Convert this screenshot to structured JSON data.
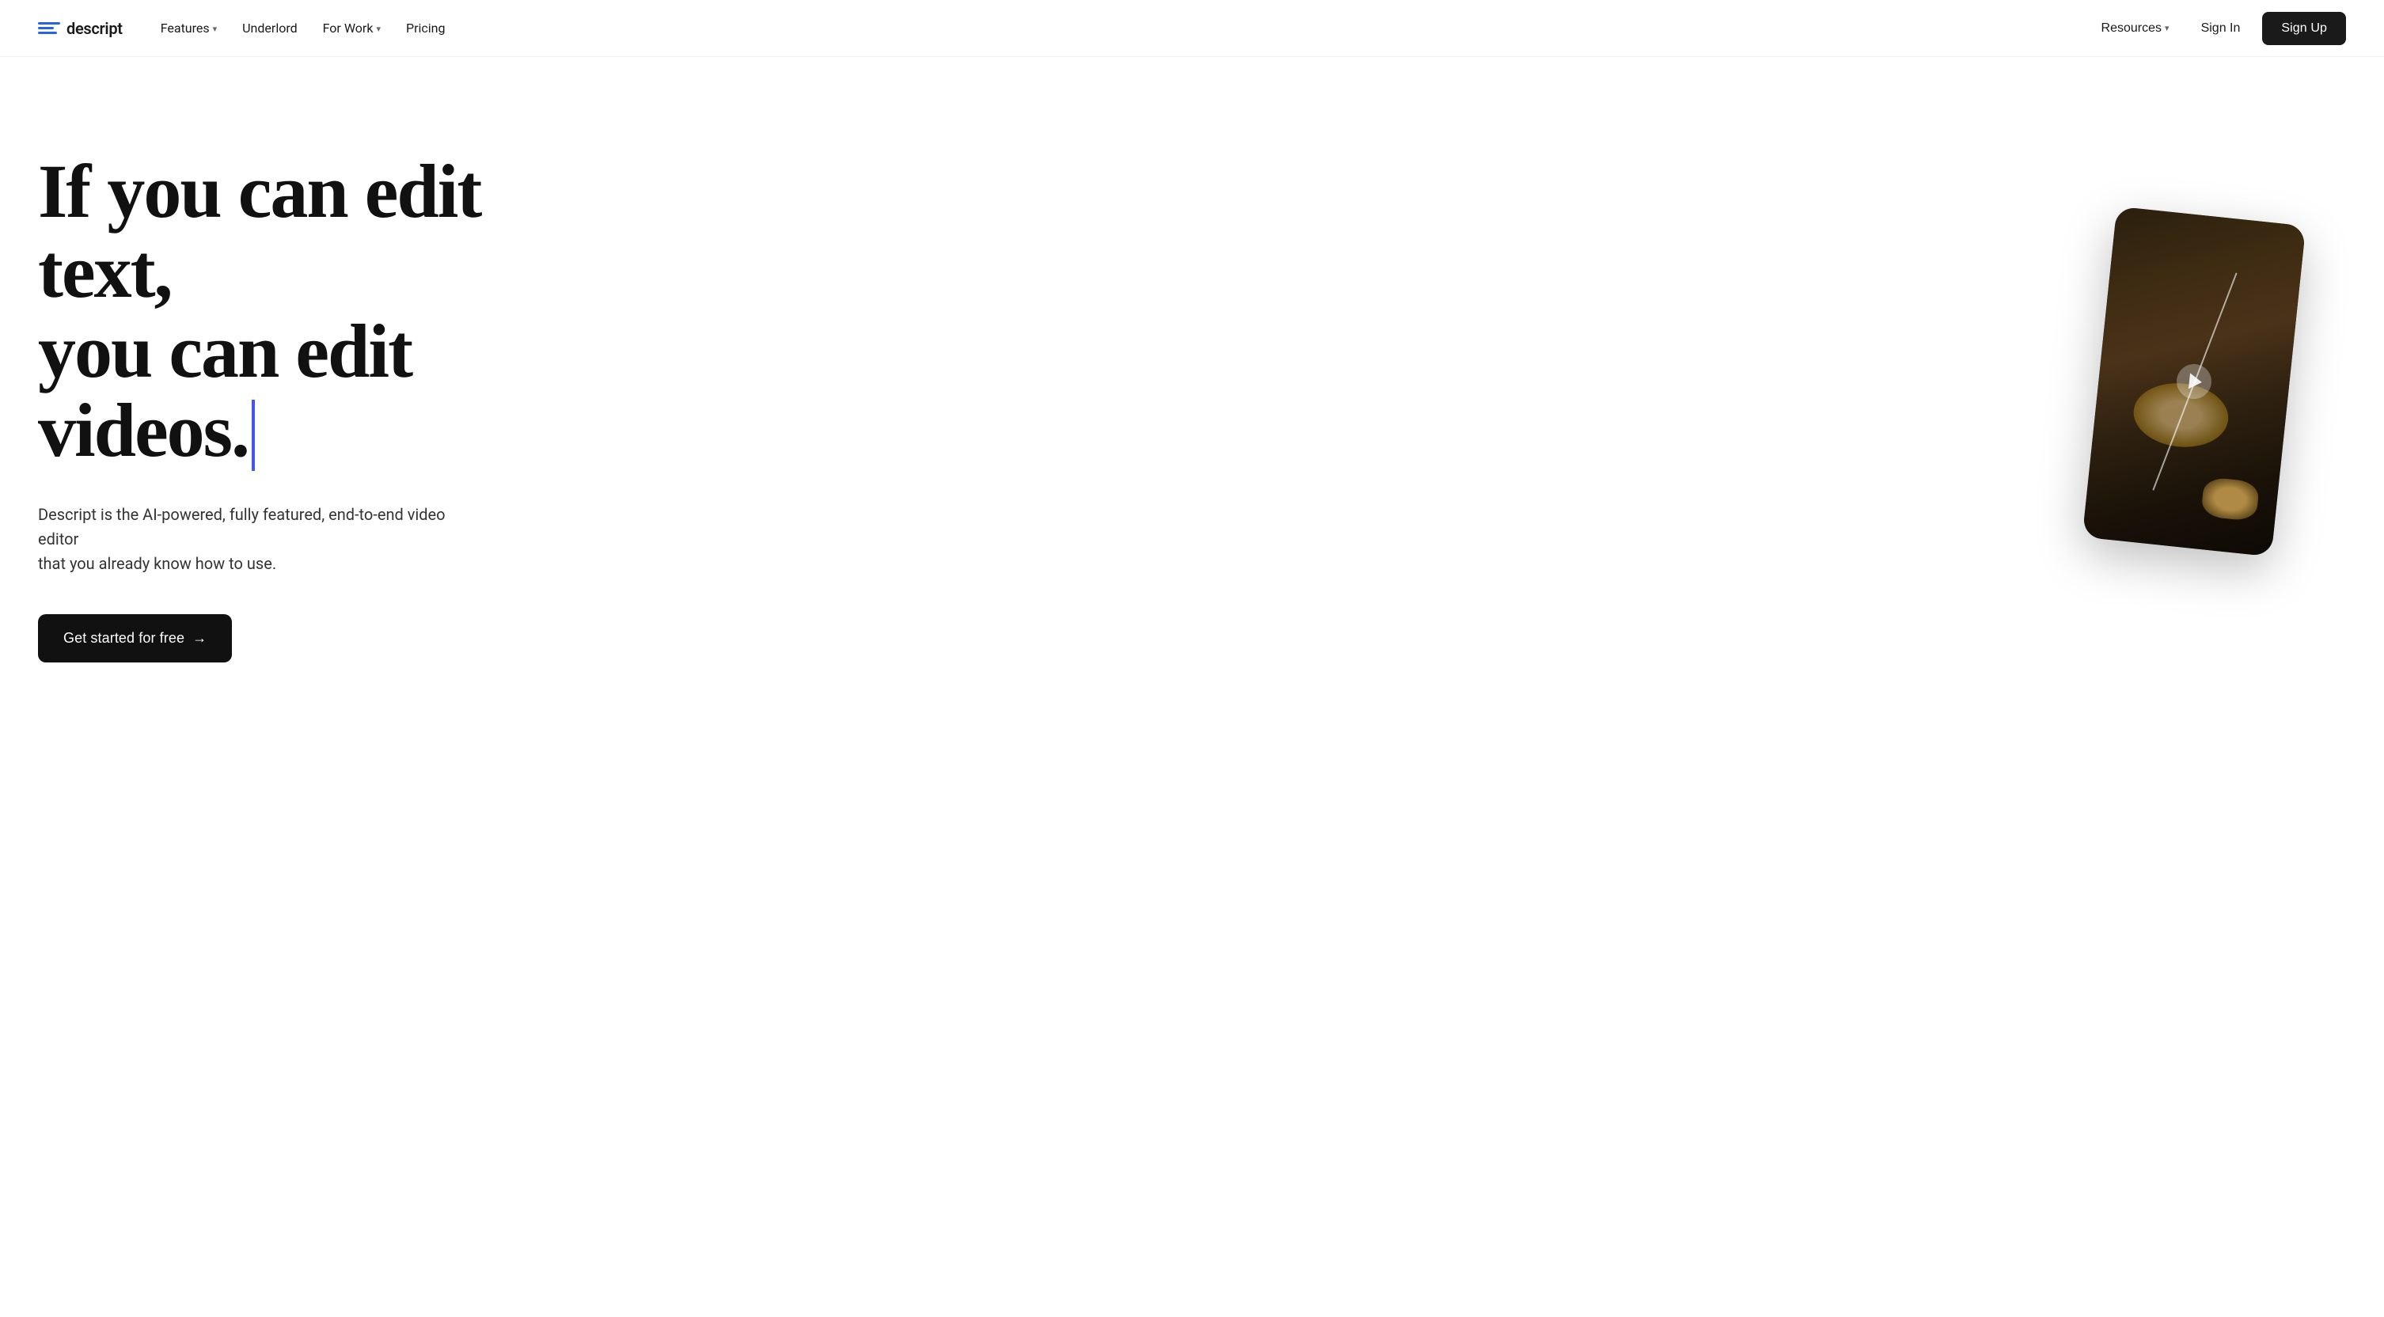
{
  "nav": {
    "logo_text": "descript",
    "items": [
      {
        "label": "Features",
        "has_dropdown": true
      },
      {
        "label": "Underlord",
        "has_dropdown": false
      },
      {
        "label": "For Work",
        "has_dropdown": true
      },
      {
        "label": "Pricing",
        "has_dropdown": false
      }
    ],
    "right": {
      "resources_label": "Resources",
      "signin_label": "Sign In",
      "signup_label": "Sign Up"
    }
  },
  "hero": {
    "heading_line1": "If you can edit text,",
    "heading_line2": "you can edit videos.",
    "subtext_line1": "Descript is the AI-powered, fully featured, end-to-end video editor",
    "subtext_line2": "that you already know how to use.",
    "cta_label": "Get started for free",
    "cta_arrow": "→"
  },
  "colors": {
    "accent_blue": "#4356f0",
    "nav_bg": "#ffffff",
    "text_dark": "#111111",
    "cta_bg": "#111111",
    "signup_bg": "#1a1a1a"
  }
}
